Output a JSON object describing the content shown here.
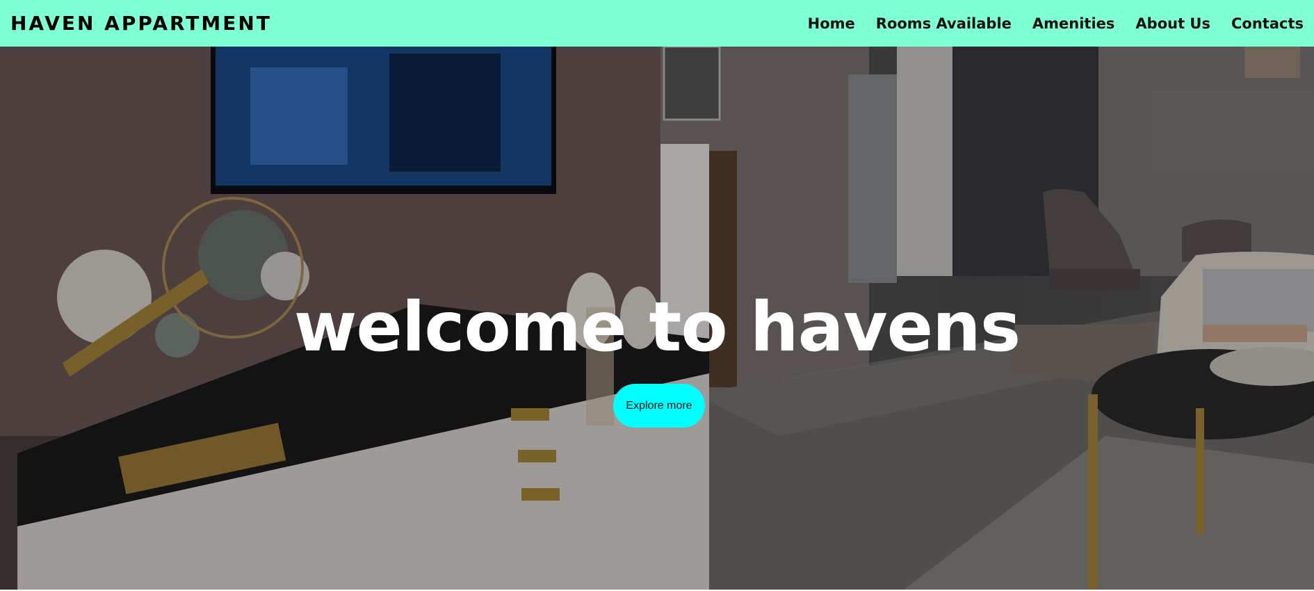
{
  "header": {
    "brand": "HAVEN APPARTMENT",
    "nav": [
      {
        "label": "Home"
      },
      {
        "label": "Rooms Available"
      },
      {
        "label": "Amenities"
      },
      {
        "label": "About Us"
      },
      {
        "label": "Contacts"
      }
    ]
  },
  "hero": {
    "title": "welcome to havens",
    "cta_label": "Explore more",
    "background_image": "living-room-photo"
  },
  "colors": {
    "navbar_bg": "#7fffd4",
    "cta_bg": "#00ffff",
    "hero_text": "#ffffff"
  }
}
